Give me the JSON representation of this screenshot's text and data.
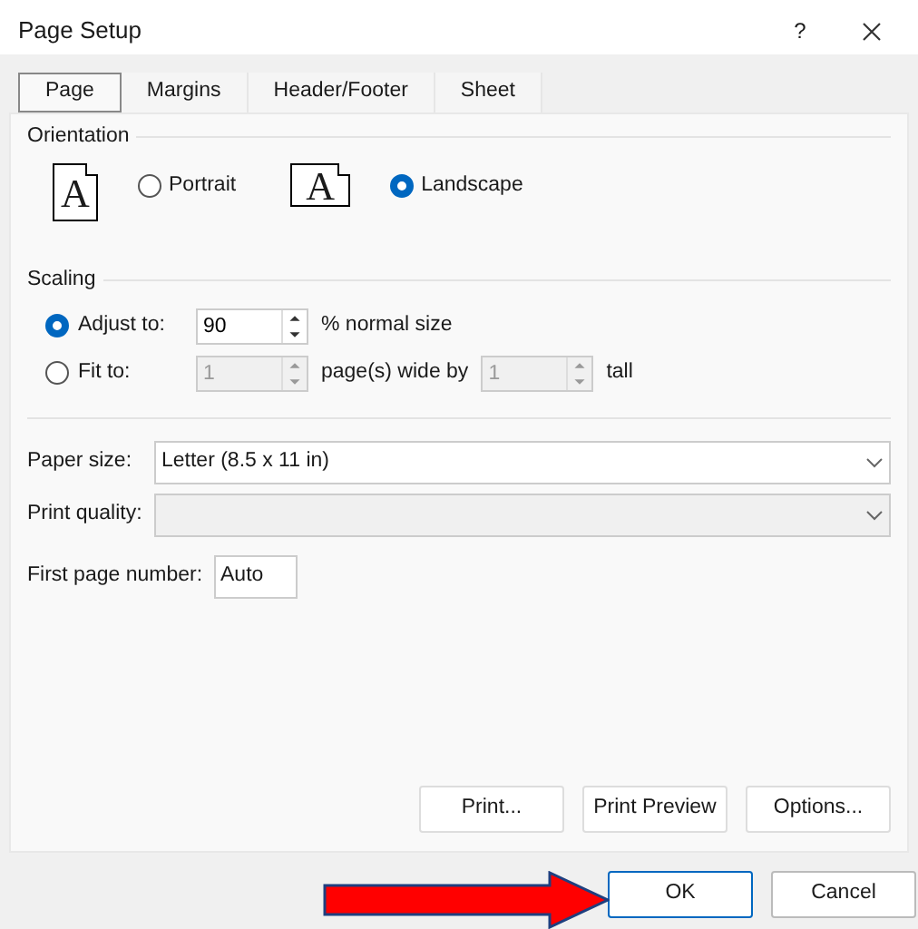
{
  "window": {
    "title": "Page Setup",
    "help": "?"
  },
  "tabs": [
    {
      "label": "Page",
      "selected": true
    },
    {
      "label": "Margins",
      "selected": false
    },
    {
      "label": "Header/Footer",
      "selected": false
    },
    {
      "label": "Sheet",
      "selected": false
    }
  ],
  "orientation": {
    "title": "Orientation",
    "options": [
      {
        "kind": "portrait",
        "glyph": "A",
        "label": "Portrait",
        "selected": false
      },
      {
        "kind": "landscape",
        "glyph": "A",
        "label": "Landscape",
        "selected": true
      }
    ]
  },
  "scaling": {
    "title": "Scaling",
    "options": [
      {
        "label": "Adjust to:",
        "selected": true,
        "parts": [
          {
            "kind": "spinner",
            "value": "90",
            "disabled": false
          },
          {
            "kind": "text",
            "text": "% normal size"
          }
        ]
      },
      {
        "label": "Fit to:",
        "selected": false,
        "parts": [
          {
            "kind": "spinner",
            "value": "1",
            "disabled": true
          },
          {
            "kind": "text",
            "text": "page(s) wide by"
          },
          {
            "kind": "spinner",
            "value": "1",
            "disabled": true
          },
          {
            "kind": "text",
            "text": "tall"
          }
        ]
      }
    ]
  },
  "paper_size": {
    "label": "Paper size:",
    "value": "Letter (8.5 x 11 in)",
    "disabled": false
  },
  "print_quality": {
    "label": "Print quality:",
    "disabled": true
  },
  "first_page_number": {
    "label": "First page number:",
    "value": "Auto"
  },
  "buttons": [
    {
      "label": "Print..."
    },
    {
      "label": "Print Preview"
    },
    {
      "label": "Options..."
    }
  ],
  "footer_buttons": [
    {
      "label": "OK",
      "default": true
    },
    {
      "label": "Cancel",
      "default": false
    }
  ]
}
